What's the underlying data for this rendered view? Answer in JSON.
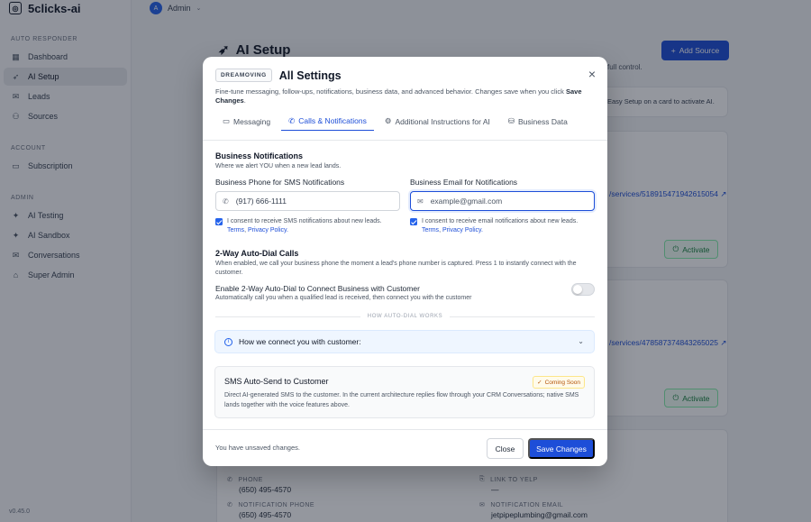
{
  "app": {
    "brand": "5clicks-ai",
    "user": "Admin",
    "user_initial": "A",
    "version": "v0.45.0"
  },
  "sidebar": {
    "sections": [
      {
        "title": "AUTO RESPONDER",
        "items": [
          {
            "label": "Dashboard"
          },
          {
            "label": "AI Setup"
          },
          {
            "label": "Leads"
          },
          {
            "label": "Sources"
          }
        ]
      },
      {
        "title": "ACCOUNT",
        "items": [
          {
            "label": "Subscription"
          }
        ]
      },
      {
        "title": "ADMIN",
        "items": [
          {
            "label": "AI Testing"
          },
          {
            "label": "AI Sandbox"
          },
          {
            "label": "Conversations"
          },
          {
            "label": "Super Admin"
          }
        ]
      }
    ]
  },
  "background": {
    "page_title": "AI Setup",
    "add_source": "Add Source",
    "subtitle_tail": "full control.",
    "note": "Easy Setup on a card to activate AI.",
    "link1": "/services/518915471942615054",
    "link2": "/services/478587374843265025",
    "activate": "Activate",
    "fields": {
      "phone_label": "PHONE",
      "phone": "(650) 495-4570",
      "yelp_label": "LINK TO YELP",
      "yelp": "—",
      "notif_phone_label": "NOTIFICATION PHONE",
      "notif_phone": "(650) 495-4570",
      "notif_email_label": "NOTIFICATION EMAIL",
      "notif_email": "jetpipeplumbing@gmail.com"
    }
  },
  "modal": {
    "badge": "DREAMOVING",
    "title": "All Settings",
    "description_main": "Fine-tune messaging, follow-ups, notifications, business data, and advanced behavior. Changes save when you click ",
    "description_bold": "Save Changes",
    "description_end": ".",
    "tabs": [
      {
        "label": "Messaging"
      },
      {
        "label": "Calls & Notifications"
      },
      {
        "label": "Additional Instructions for AI"
      },
      {
        "label": "Business Data"
      }
    ],
    "notifications": {
      "title": "Business Notifications",
      "subtitle": "Where we alert YOU when a new lead lands.",
      "phone_label": "Business Phone for SMS Notifications",
      "phone_value": "(917) 666-1111",
      "email_label": "Business Email for Notifications",
      "email_placeholder": "example@gmail.com",
      "sms_consent": "I consent to receive SMS notifications about new leads.",
      "email_consent": "I consent to receive email notifications about new leads.",
      "terms": "Terms",
      "privacy": "Privacy Policy."
    },
    "autodial": {
      "title": "2-Way Auto-Dial Calls",
      "subtitle": "When enabled, we call your business phone the moment a lead's phone number is captured. Press 1 to instantly connect with the customer.",
      "enable_label": "Enable 2-Way Auto-Dial to Connect Business with Customer",
      "enable_sub": "Automatically call you when a qualified lead is received, then connect you with the customer",
      "enabled": false,
      "divider": "HOW AUTO-DIAL WORKS",
      "accordion": "How we connect you with customer:"
    },
    "sms_card": {
      "title": "SMS Auto-Send to Customer",
      "badge": "Coming Soon",
      "description": "Direct AI-generated SMS to the customer. In the current architecture replies flow through your CRM Conversations; native SMS lands together with the voice features above."
    },
    "footer": {
      "unsaved": "You have unsaved changes.",
      "close": "Close",
      "save": "Save Changes"
    }
  }
}
